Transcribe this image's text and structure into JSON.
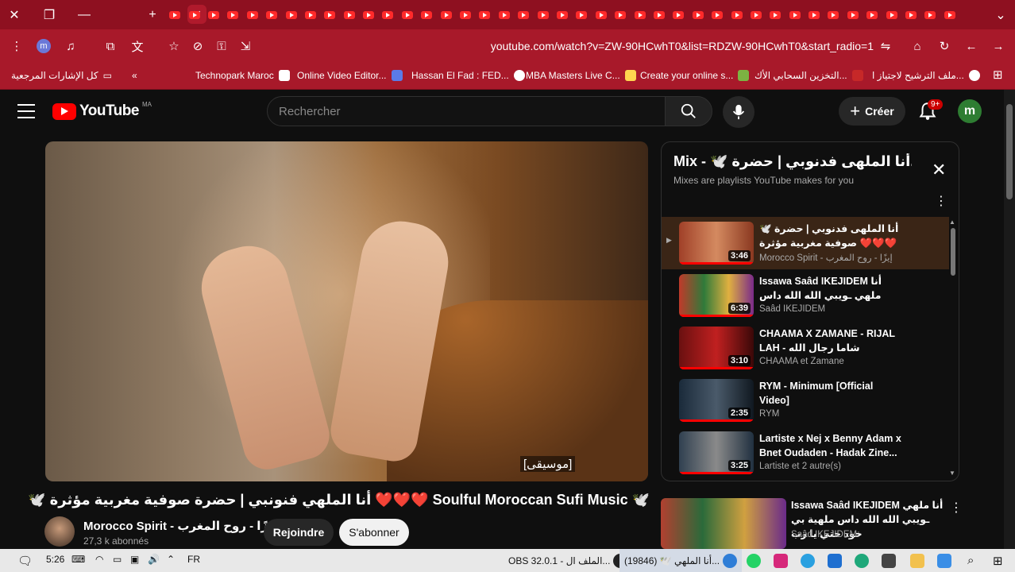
{
  "browser": {
    "url": "youtube.com/watch?v=ZW-90HCwhT0&list=RDZW-90HCwhT0&start_radio=1",
    "profile_letter": "m",
    "bookmarks": [
      {
        "label": "كل الإشارات المرجعية"
      },
      {
        "label": "Technopark Maroc"
      },
      {
        "label": "Online Video Editor..."
      },
      {
        "label": "Hassan El Fad : FED..."
      },
      {
        "label": "MBA Masters Live C..."
      },
      {
        "label": "Create your online s..."
      },
      {
        "label": "التخزين السحابي الأك..."
      },
      {
        "label": "ملف الترشيح لاجتياز ا..."
      }
    ]
  },
  "yt": {
    "logo_text": "YouTube",
    "country": "MA",
    "search_placeholder": "Rechercher",
    "create_label": "Créer",
    "notif_badge": "9+",
    "avatar_letter": "m"
  },
  "video": {
    "caption": "[موسيقى]",
    "title": "🕊️ Soulful Moroccan Sufi Music ❤️❤️❤️ أنا الملهي فنونبي | حضرة صوفية مغربية مؤثرة 🕊️",
    "channel": "Morocco Spirit - إيزًا - روح المغرب",
    "subscribers": "27,3 k abonnés",
    "join_label": "Rejoindre",
    "subscribe_label": "S'abonner"
  },
  "playlist": {
    "title": "Mix - 🕊️ أنا الملهى فدنوبي | حضرة...",
    "subtitle": "Mixes are playlists YouTube makes for you",
    "items": [
      {
        "title": "🕊️ أنا الملهى فدنوبي | حضرة صوفية مغربية مؤثرة ❤️❤️❤️ Soulful...",
        "channel": "Morocco Spirit - إيزًا - روح المغرب",
        "duration": "3:46"
      },
      {
        "title": "Issawa Saâd IKEJIDEM أنا ملهي ـويبي الله الله داس ملهية بي خود حتي يا رب",
        "channel": "Saâd IKEJIDEM",
        "duration": "6:39"
      },
      {
        "title": "CHAAMA X ZAMANE - RIJAL LAH - شاما رجال الله",
        "channel": "CHAAMA et Zamane",
        "duration": "3:10"
      },
      {
        "title": "RYM - Minimum [Official Video]",
        "channel": "RYM",
        "duration": "2:35"
      },
      {
        "title": "Lartiste x Nej x Benny Adam x Bnet Oudaden - Hadak Zine...",
        "channel": "Lartiste et 2 autre(s)",
        "duration": "3:25"
      }
    ]
  },
  "recommended": {
    "title": "Issawa Saâd IKEJIDEM أنا ملهي ـويبي الله الله داس ملهية بي خود حتي يا رب",
    "channel": "Saâd IKEJIDEM"
  },
  "taskbar": {
    "time": "5:26",
    "lang": "FR",
    "obs_label": "OBS 32.0.1 - الملف ال...",
    "chrome_label": "(19846) 🕊️ أنا الملهي..."
  },
  "colors": {
    "browser_red": "#a8192a",
    "youtube_red": "#ff0000",
    "background": "#0f0f0f"
  }
}
